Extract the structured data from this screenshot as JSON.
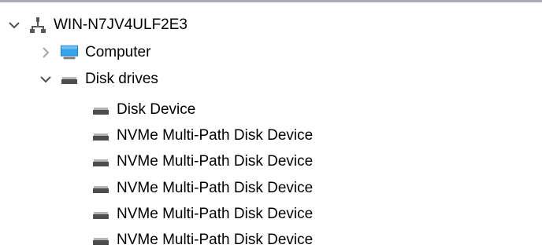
{
  "tree": {
    "root": {
      "label": "WIN-N7JV4ULF2E3",
      "icon": "network-computer-icon",
      "expanded": true
    },
    "computer": {
      "label": "Computer",
      "icon": "monitor-icon",
      "expanded": false
    },
    "disk_drives": {
      "label": "Disk drives",
      "icon": "disk-drive-icon",
      "expanded": true,
      "children": [
        {
          "label": "Disk Device",
          "icon": "disk-drive-icon"
        },
        {
          "label": "NVMe Multi-Path Disk Device",
          "icon": "disk-drive-icon"
        },
        {
          "label": "NVMe Multi-Path Disk Device",
          "icon": "disk-drive-icon"
        },
        {
          "label": "NVMe Multi-Path Disk Device",
          "icon": "disk-drive-icon"
        },
        {
          "label": "NVMe Multi-Path Disk Device",
          "icon": "disk-drive-icon"
        },
        {
          "label": "NVMe Multi-Path Disk Device",
          "icon": "disk-drive-icon"
        }
      ]
    }
  },
  "colors": {
    "chevron": "#505050",
    "chevron_collapsed": "#a6a6a6",
    "top_border": "#abadb3",
    "monitor_screen": "#1f8fd8",
    "drive_body": "#4d4d4d"
  }
}
